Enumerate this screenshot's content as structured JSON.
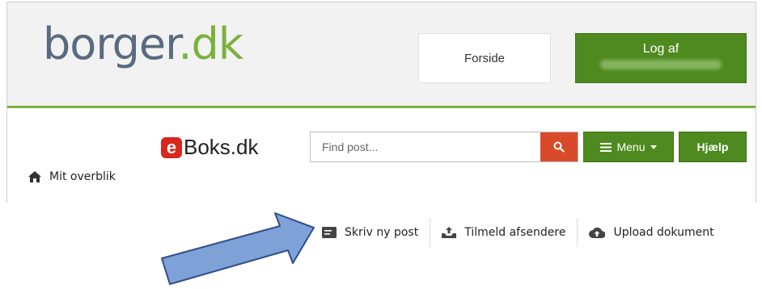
{
  "header": {
    "logo_part1": "borger",
    "logo_part2": ".dk",
    "forside_label": "Forside",
    "logaf_label": "Log af"
  },
  "eboks": {
    "logo_e": "e",
    "logo_text": "Boks.dk",
    "search_placeholder": "Find post...",
    "menu_label": "Menu",
    "help_label": "Hjælp",
    "overview_label": "Mit overblik"
  },
  "actions": [
    {
      "label": "Skriv ny post",
      "icon": "compose-icon"
    },
    {
      "label": "Tilmeld afsendere",
      "icon": "inbox-upload-icon"
    },
    {
      "label": "Upload dokument",
      "icon": "cloud-upload-icon"
    }
  ],
  "colors": {
    "green": "#4e8a1f",
    "accent_green": "#7bb13c",
    "search_red": "#d94a2b",
    "eboks_red": "#d9271d",
    "arrow_blue": "#7ea1d8"
  }
}
